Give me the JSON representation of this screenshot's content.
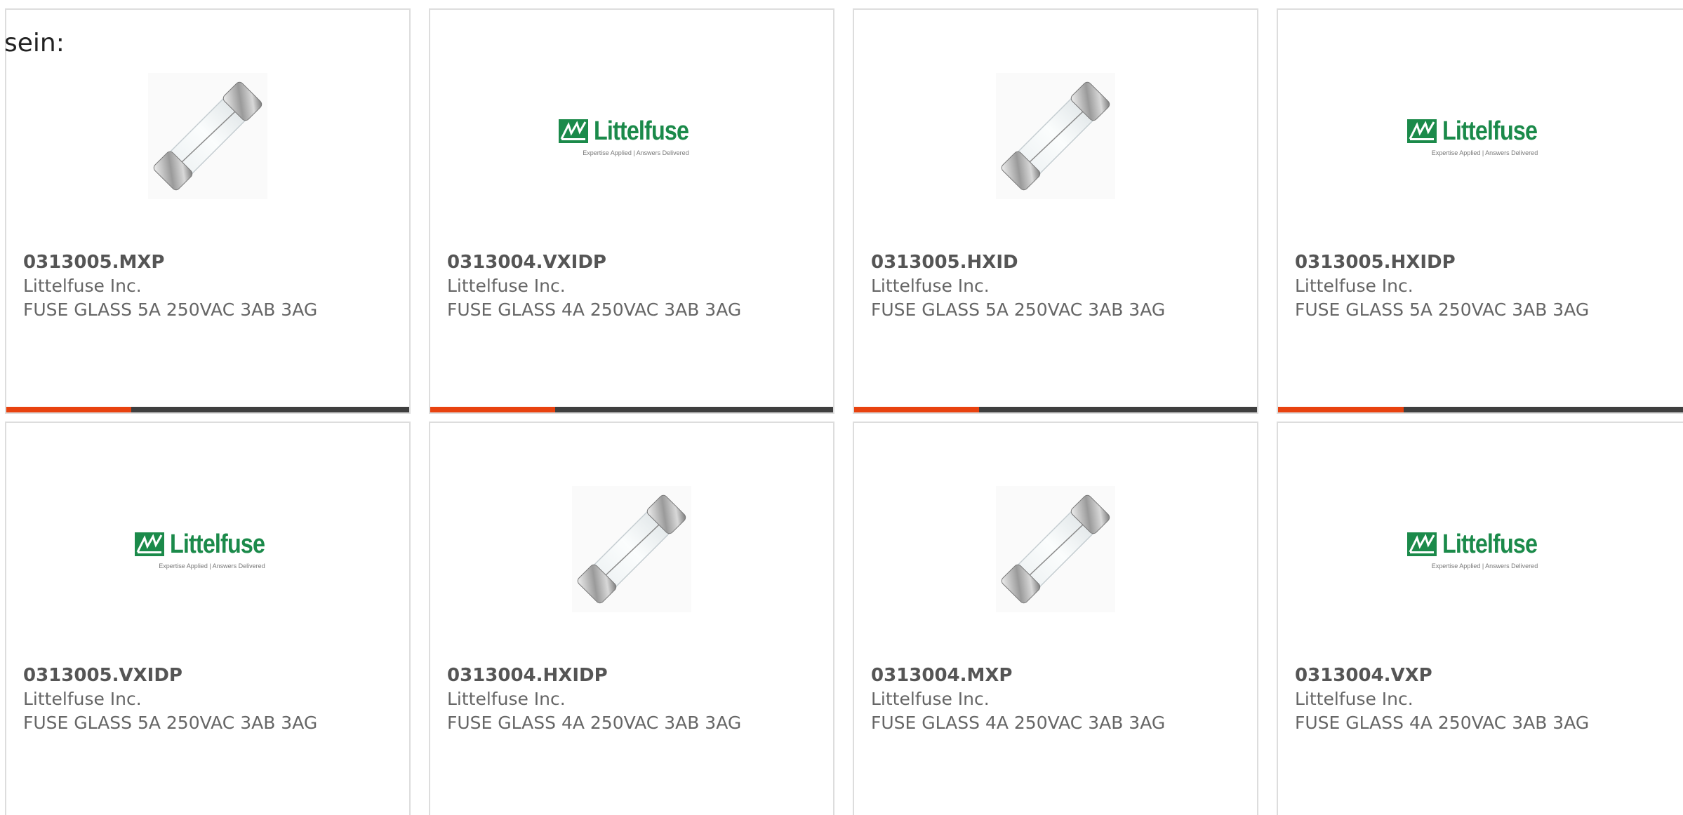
{
  "intro_text": "sein:",
  "colors": {
    "progress_fill": "#e8420f",
    "progress_track": "#3f3f3f",
    "border": "#dddddd",
    "logo_green": "#1b8a4a"
  },
  "products": [
    {
      "part": "0313005.MXP",
      "manufacturer": "Littelfuse Inc.",
      "description": "FUSE GLASS 5A 250VAC 3AB 3AG",
      "image": "fuse-photo",
      "progress": 0.31
    },
    {
      "part": "0313004.VXIDP",
      "manufacturer": "Littelfuse Inc.",
      "description": "FUSE GLASS 4A 250VAC 3AB 3AG",
      "image": "littelfuse-logo",
      "progress": 0.31
    },
    {
      "part": "0313005.HXID",
      "manufacturer": "Littelfuse Inc.",
      "description": "FUSE GLASS 5A 250VAC 3AB 3AG",
      "image": "fuse-photo",
      "progress": 0.31
    },
    {
      "part": "0313005.HXIDP",
      "manufacturer": "Littelfuse Inc.",
      "description": "FUSE GLASS 5A 250VAC 3AB 3AG",
      "image": "littelfuse-logo",
      "progress": 0.31
    },
    {
      "part": "0313005.VXIDP",
      "manufacturer": "Littelfuse Inc.",
      "description": "FUSE GLASS 5A 250VAC 3AB 3AG",
      "image": "littelfuse-logo",
      "progress": null
    },
    {
      "part": "0313004.HXIDP",
      "manufacturer": "Littelfuse Inc.",
      "description": "FUSE GLASS 4A 250VAC 3AB 3AG",
      "image": "fuse-photo",
      "progress": null
    },
    {
      "part": "0313004.MXP",
      "manufacturer": "Littelfuse Inc.",
      "description": "FUSE GLASS 4A 250VAC 3AB 3AG",
      "image": "fuse-photo",
      "progress": null
    },
    {
      "part": "0313004.VXP",
      "manufacturer": "Littelfuse Inc.",
      "description": "FUSE GLASS 4A 250VAC 3AB 3AG",
      "image": "littelfuse-logo",
      "progress": null
    }
  ],
  "logo": {
    "wordmark": "Littelfuse",
    "tagline": "Expertise Applied | Answers Delivered"
  }
}
